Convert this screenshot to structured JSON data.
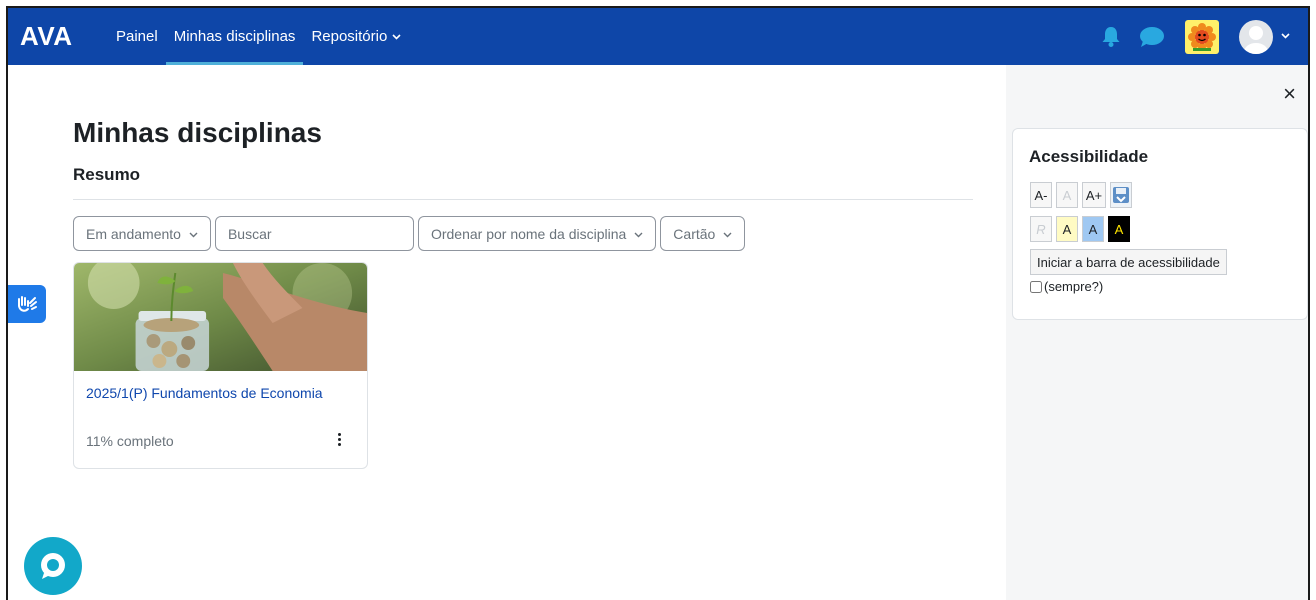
{
  "brand": "AVA",
  "nav": {
    "links": [
      {
        "label": "Painel"
      },
      {
        "label": "Minhas disciplinas"
      },
      {
        "label": "Repositório"
      }
    ]
  },
  "page": {
    "title": "Minhas disciplinas",
    "section": "Resumo"
  },
  "filters": {
    "status": "Em andamento",
    "search_placeholder": "Buscar",
    "sort": "Ordenar por nome da disciplina",
    "view": "Cartão"
  },
  "course": {
    "name": "2025/1(P) Fundamentos de Economia",
    "progress": "11% completo"
  },
  "drawer": {
    "close": "×",
    "block_title": "Acessibilidade",
    "buttons_row1": [
      "A-",
      "A",
      "A+"
    ],
    "buttons_row2": [
      "R",
      "A",
      "A",
      "A"
    ],
    "start_bar": "Iniciar a barra de acessibilidade",
    "always": "(sempre?)"
  },
  "colors": {
    "navbar": "#0e46a8",
    "active_underline": "#4fb0d9",
    "link": "#0f47ad",
    "chat_bubble": "#12a8c9"
  }
}
